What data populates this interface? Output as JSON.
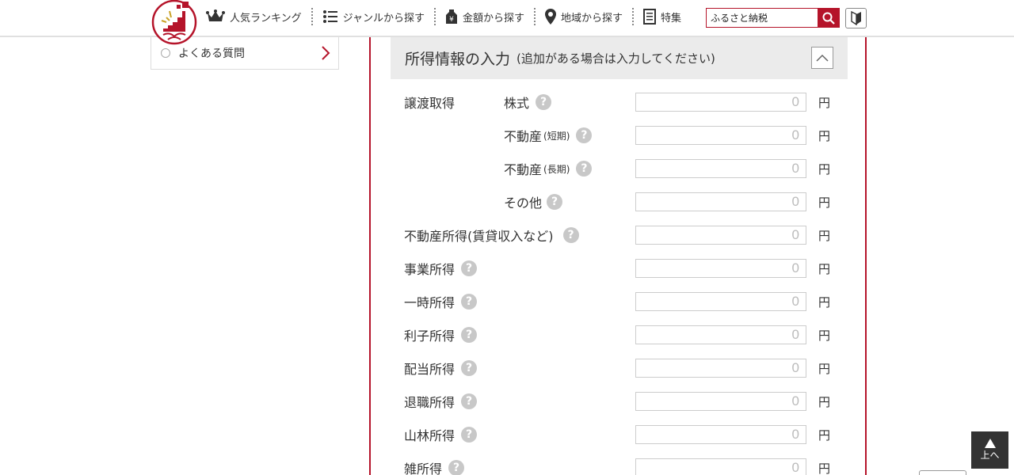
{
  "header": {
    "nav": [
      {
        "label": "人気ランキング",
        "icon": "crown-icon"
      },
      {
        "label": "ジャンルから探す",
        "icon": "list-icon"
      },
      {
        "label": "金額から探す",
        "icon": "yen-tag-icon"
      },
      {
        "label": "地域から探す",
        "icon": "map-pin-icon"
      },
      {
        "label": "特集",
        "icon": "document-icon"
      }
    ],
    "search": {
      "value": "ふるさと納税",
      "icon": "search-icon"
    },
    "beginner_icon": "beginner-mark-icon"
  },
  "sidebar": {
    "item_label": "よくある質問"
  },
  "panel": {
    "title": "所得情報の入力",
    "subtitle": "(追加がある場合は入力してください)",
    "help_mark": "?",
    "unit": "円",
    "group_label": "譲渡取得",
    "rows": [
      {
        "label": "株式",
        "small": "",
        "value": "0"
      },
      {
        "label": "不動産",
        "small": "(短期)",
        "value": "0"
      },
      {
        "label": "不動産",
        "small": "(長期)",
        "value": "0"
      },
      {
        "label": "その他",
        "small": "",
        "value": "0"
      },
      {
        "label": "不動産所得(賃貸収入など)",
        "small": "",
        "value": "0"
      },
      {
        "label": "事業所得",
        "small": "",
        "value": "0"
      },
      {
        "label": "一時所得",
        "small": "",
        "value": "0"
      },
      {
        "label": "利子所得",
        "small": "",
        "value": "0"
      },
      {
        "label": "配当所得",
        "small": "",
        "value": "0"
      },
      {
        "label": "退職所得",
        "small": "",
        "value": "0"
      },
      {
        "label": "山林所得",
        "small": "",
        "value": "0"
      },
      {
        "label": "雑所得",
        "small": "",
        "value": "0"
      }
    ]
  },
  "totop": {
    "label": "上へ"
  },
  "colors": {
    "accent": "#b5142a",
    "panel_header_bg": "#ebebeb"
  }
}
